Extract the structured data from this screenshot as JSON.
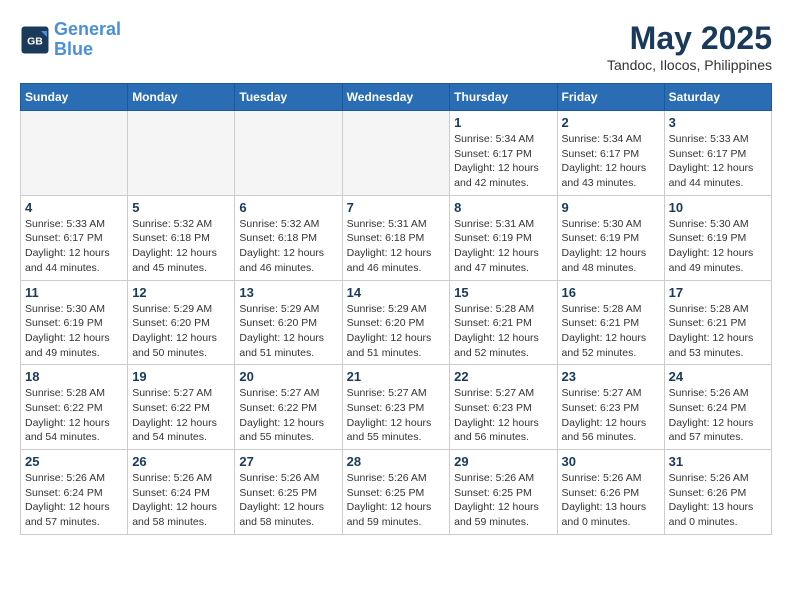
{
  "header": {
    "logo_line1": "General",
    "logo_line2": "Blue",
    "month_year": "May 2025",
    "location": "Tandoc, Ilocos, Philippines"
  },
  "days_of_week": [
    "Sunday",
    "Monday",
    "Tuesday",
    "Wednesday",
    "Thursday",
    "Friday",
    "Saturday"
  ],
  "weeks": [
    [
      {
        "day": "",
        "info": ""
      },
      {
        "day": "",
        "info": ""
      },
      {
        "day": "",
        "info": ""
      },
      {
        "day": "",
        "info": ""
      },
      {
        "day": "1",
        "info": "Sunrise: 5:34 AM\nSunset: 6:17 PM\nDaylight: 12 hours\nand 42 minutes."
      },
      {
        "day": "2",
        "info": "Sunrise: 5:34 AM\nSunset: 6:17 PM\nDaylight: 12 hours\nand 43 minutes."
      },
      {
        "day": "3",
        "info": "Sunrise: 5:33 AM\nSunset: 6:17 PM\nDaylight: 12 hours\nand 44 minutes."
      }
    ],
    [
      {
        "day": "4",
        "info": "Sunrise: 5:33 AM\nSunset: 6:17 PM\nDaylight: 12 hours\nand 44 minutes."
      },
      {
        "day": "5",
        "info": "Sunrise: 5:32 AM\nSunset: 6:18 PM\nDaylight: 12 hours\nand 45 minutes."
      },
      {
        "day": "6",
        "info": "Sunrise: 5:32 AM\nSunset: 6:18 PM\nDaylight: 12 hours\nand 46 minutes."
      },
      {
        "day": "7",
        "info": "Sunrise: 5:31 AM\nSunset: 6:18 PM\nDaylight: 12 hours\nand 46 minutes."
      },
      {
        "day": "8",
        "info": "Sunrise: 5:31 AM\nSunset: 6:19 PM\nDaylight: 12 hours\nand 47 minutes."
      },
      {
        "day": "9",
        "info": "Sunrise: 5:30 AM\nSunset: 6:19 PM\nDaylight: 12 hours\nand 48 minutes."
      },
      {
        "day": "10",
        "info": "Sunrise: 5:30 AM\nSunset: 6:19 PM\nDaylight: 12 hours\nand 49 minutes."
      }
    ],
    [
      {
        "day": "11",
        "info": "Sunrise: 5:30 AM\nSunset: 6:19 PM\nDaylight: 12 hours\nand 49 minutes."
      },
      {
        "day": "12",
        "info": "Sunrise: 5:29 AM\nSunset: 6:20 PM\nDaylight: 12 hours\nand 50 minutes."
      },
      {
        "day": "13",
        "info": "Sunrise: 5:29 AM\nSunset: 6:20 PM\nDaylight: 12 hours\nand 51 minutes."
      },
      {
        "day": "14",
        "info": "Sunrise: 5:29 AM\nSunset: 6:20 PM\nDaylight: 12 hours\nand 51 minutes."
      },
      {
        "day": "15",
        "info": "Sunrise: 5:28 AM\nSunset: 6:21 PM\nDaylight: 12 hours\nand 52 minutes."
      },
      {
        "day": "16",
        "info": "Sunrise: 5:28 AM\nSunset: 6:21 PM\nDaylight: 12 hours\nand 52 minutes."
      },
      {
        "day": "17",
        "info": "Sunrise: 5:28 AM\nSunset: 6:21 PM\nDaylight: 12 hours\nand 53 minutes."
      }
    ],
    [
      {
        "day": "18",
        "info": "Sunrise: 5:28 AM\nSunset: 6:22 PM\nDaylight: 12 hours\nand 54 minutes."
      },
      {
        "day": "19",
        "info": "Sunrise: 5:27 AM\nSunset: 6:22 PM\nDaylight: 12 hours\nand 54 minutes."
      },
      {
        "day": "20",
        "info": "Sunrise: 5:27 AM\nSunset: 6:22 PM\nDaylight: 12 hours\nand 55 minutes."
      },
      {
        "day": "21",
        "info": "Sunrise: 5:27 AM\nSunset: 6:23 PM\nDaylight: 12 hours\nand 55 minutes."
      },
      {
        "day": "22",
        "info": "Sunrise: 5:27 AM\nSunset: 6:23 PM\nDaylight: 12 hours\nand 56 minutes."
      },
      {
        "day": "23",
        "info": "Sunrise: 5:27 AM\nSunset: 6:23 PM\nDaylight: 12 hours\nand 56 minutes."
      },
      {
        "day": "24",
        "info": "Sunrise: 5:26 AM\nSunset: 6:24 PM\nDaylight: 12 hours\nand 57 minutes."
      }
    ],
    [
      {
        "day": "25",
        "info": "Sunrise: 5:26 AM\nSunset: 6:24 PM\nDaylight: 12 hours\nand 57 minutes."
      },
      {
        "day": "26",
        "info": "Sunrise: 5:26 AM\nSunset: 6:24 PM\nDaylight: 12 hours\nand 58 minutes."
      },
      {
        "day": "27",
        "info": "Sunrise: 5:26 AM\nSunset: 6:25 PM\nDaylight: 12 hours\nand 58 minutes."
      },
      {
        "day": "28",
        "info": "Sunrise: 5:26 AM\nSunset: 6:25 PM\nDaylight: 12 hours\nand 59 minutes."
      },
      {
        "day": "29",
        "info": "Sunrise: 5:26 AM\nSunset: 6:25 PM\nDaylight: 12 hours\nand 59 minutes."
      },
      {
        "day": "30",
        "info": "Sunrise: 5:26 AM\nSunset: 6:26 PM\nDaylight: 13 hours\nand 0 minutes."
      },
      {
        "day": "31",
        "info": "Sunrise: 5:26 AM\nSunset: 6:26 PM\nDaylight: 13 hours\nand 0 minutes."
      }
    ]
  ]
}
